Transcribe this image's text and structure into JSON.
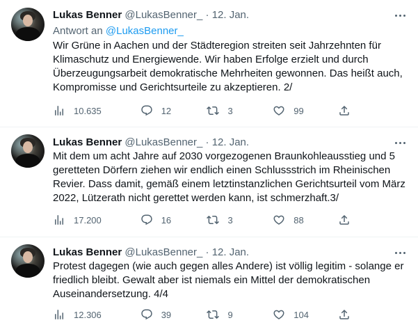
{
  "tweets": [
    {
      "author_name": "Lukas Benner",
      "handle": "@LukasBenner_",
      "separator": "·",
      "date": "12. Jan.",
      "reply_prefix": "Antwort an",
      "reply_handle": "@LukasBenner_",
      "text": "Wir Grüne in Aachen und der Städteregion streiten seit Jahrzehnten für Klimaschutz und Energiewende. Wir haben Erfolge erzielt und durch Überzeugungsarbeit demokratische Mehrheiten gewonnen. Das heißt auch, Kompromisse und Gerichtsurteile zu akzeptieren. 2/",
      "views": "10.635",
      "replies": "12",
      "retweets": "3",
      "likes": "99"
    },
    {
      "author_name": "Lukas Benner",
      "handle": "@LukasBenner_",
      "separator": "·",
      "date": "12. Jan.",
      "text": "Mit dem um acht Jahre auf 2030 vorgezogenen Braunkohleausstieg und 5 geretteten Dörfern ziehen wir endlich einen Schlussstrich im Rheinischen Revier. Dass damit, gemäß einem letztinstanzlichen Gerichtsurteil vom März 2022, Lützerath nicht gerettet werden kann, ist schmerzhaft.3/",
      "views": "17.200",
      "replies": "16",
      "retweets": "3",
      "likes": "88"
    },
    {
      "author_name": "Lukas Benner",
      "handle": "@LukasBenner_",
      "separator": "·",
      "date": "12. Jan.",
      "text": "Protest dagegen (wie auch gegen alles Andere) ist völlig legitim - solange er friedlich bleibt. Gewalt aber ist niemals ein Mittel der demokratischen Auseinandersetzung. 4/4",
      "views": "12.306",
      "replies": "39",
      "retweets": "9",
      "likes": "104"
    }
  ],
  "icons": {
    "views": "views-icon",
    "reply": "reply-icon",
    "retweet": "retweet-icon",
    "like": "like-icon",
    "share": "share-icon",
    "more": "more-icon"
  },
  "colors": {
    "link": "#1d9bf0",
    "secondary_text": "#536471",
    "primary_text": "#0f1419",
    "divider": "#eff3f4"
  }
}
